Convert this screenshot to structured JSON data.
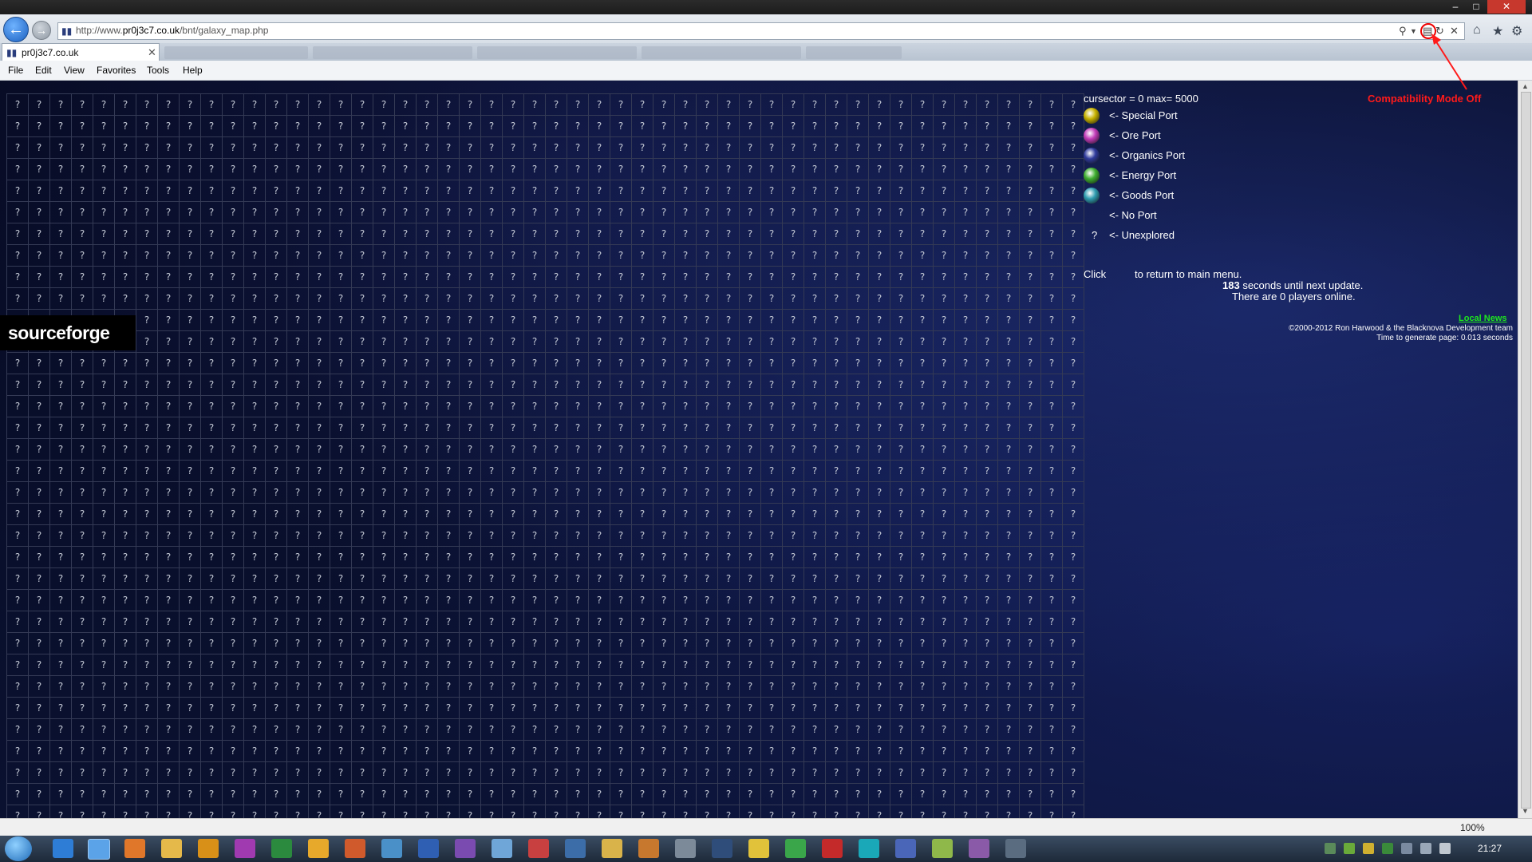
{
  "browser": {
    "url_prefix": "http://www.",
    "url_domain": "pr0j3c7.co.uk",
    "url_path": "/bnt/galaxy_map.php",
    "tab_title": "pr0j3c7.co.uk",
    "menu": [
      "File",
      "Edit",
      "View",
      "Favorites",
      "Tools",
      "Help"
    ],
    "zoom": "100%"
  },
  "window": {
    "minimize": "–",
    "maximize": "□",
    "close": "✕"
  },
  "map": {
    "unexplored_symbol": "?",
    "rows": 34,
    "cols": 50,
    "logo_text": "sourceforge"
  },
  "info": {
    "cursector": "cursector = 0 max= 5000",
    "legend": [
      {
        "label": "<- Special Port",
        "icon": "special-port-icon",
        "color": "#c8b200"
      },
      {
        "label": "<- Ore Port",
        "icon": "ore-port-icon",
        "color": "#c23bb8"
      },
      {
        "label": "<- Organics Port",
        "icon": "organics-port-icon",
        "color": "#2f3a9c"
      },
      {
        "label": "<- Energy Port",
        "icon": "energy-port-icon",
        "color": "#3fae2f"
      },
      {
        "label": "<- Goods Port",
        "icon": "goods-port-icon",
        "color": "#2e9cb0"
      },
      {
        "label": "<- No Port",
        "icon": "no-port-icon",
        "color": ""
      },
      {
        "label": "<- Unexplored",
        "icon": "unexplored-icon",
        "color": ""
      }
    ],
    "click_word": "Click",
    "click_rest": "to return to main menu.",
    "seconds": "183",
    "seconds_rest": "seconds until next update.",
    "players": "There are 0 players online.",
    "local_news": "Local News",
    "copyright": "©2000-2012 Ron Harwood & the Blacknova Development team",
    "gentime": "Time to generate page: 0.013 seconds"
  },
  "annotation": {
    "compat_label": "Compatibility Mode Off",
    "color": "#ff1a1a"
  },
  "taskbar": {
    "clock": "21:27"
  }
}
